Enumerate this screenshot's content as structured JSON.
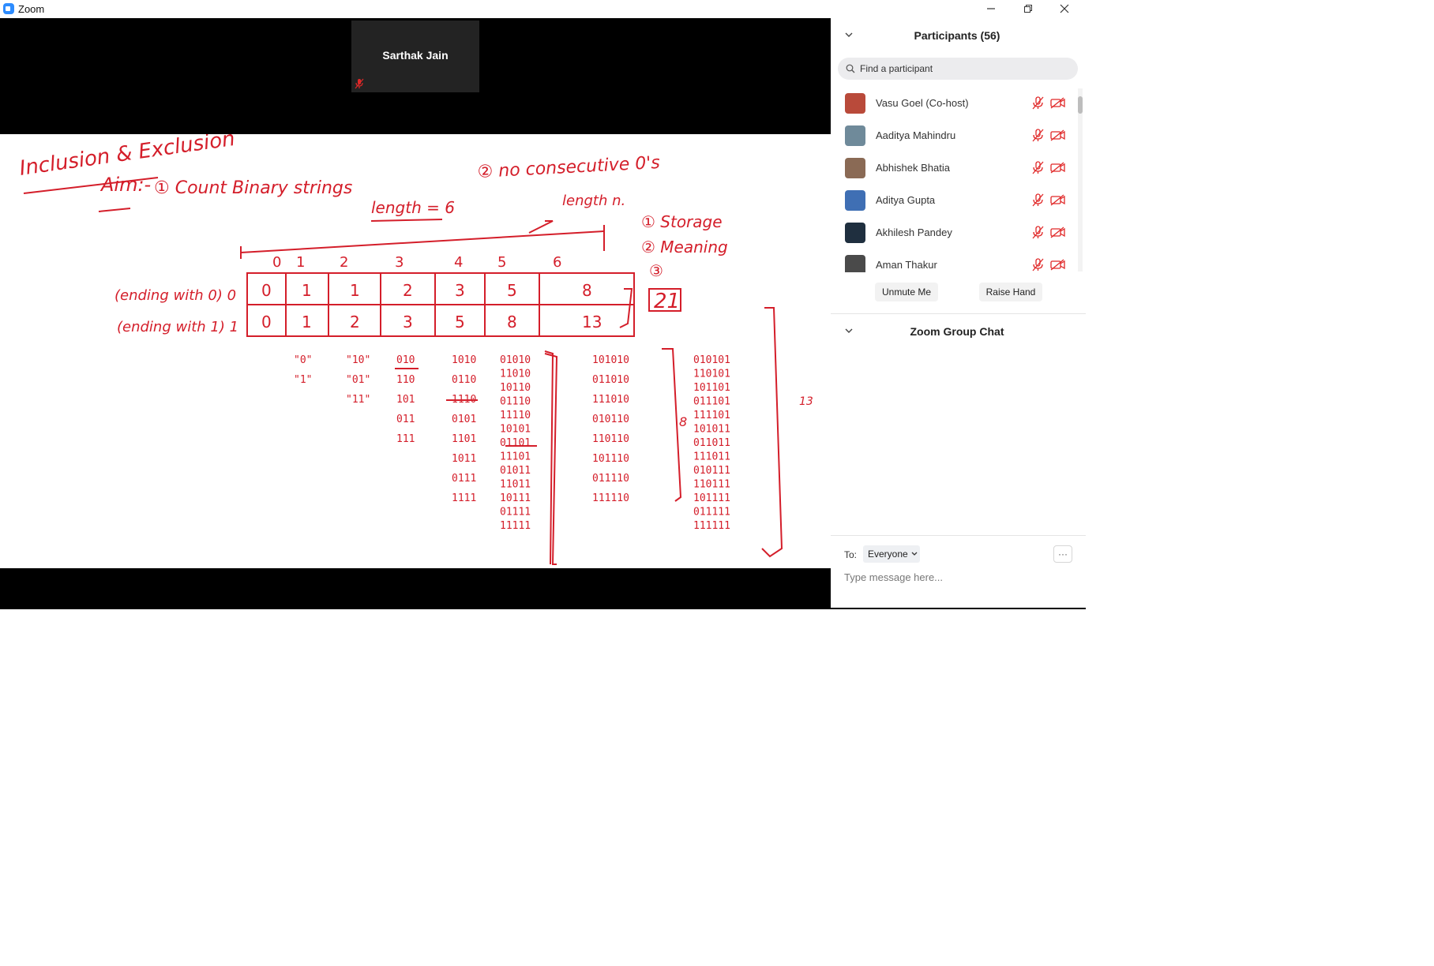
{
  "window": {
    "title": "Zoom",
    "accent_color": "#2d8cff"
  },
  "video": {
    "speaker_name": "Sarthak Jain",
    "speaker_muted": true,
    "whiteboard": {
      "title": "Inclusion & Exclusion",
      "aim_label": "Aim:-",
      "aim_items": [
        "① Count Binary strings",
        "② no consecutive 0's"
      ],
      "length_note": "length = 6",
      "length_n_note": "length n.",
      "steps": [
        "① Storage",
        "② Meaning",
        "③"
      ],
      "column_indices": [
        "0",
        "1",
        "2",
        "3",
        "4",
        "5",
        "6"
      ],
      "row_labels": [
        "(ending with 0)  0",
        "(ending with 1)  1"
      ],
      "table_rows": [
        [
          "0",
          "1",
          "1",
          "2",
          "3",
          "5",
          "8"
        ],
        [
          "0",
          "1",
          "2",
          "3",
          "5",
          "8",
          "13"
        ]
      ],
      "result": "21",
      "ink_color": "#d41e2a",
      "string_columns": [
        [
          "\"0\"",
          "\"1\""
        ],
        [
          "\"10\"",
          "\"01\"",
          "\"11\""
        ],
        [
          "010",
          "110",
          "101",
          "011",
          "111"
        ],
        [
          "1010",
          "0110",
          "1110",
          "0101",
          "1101",
          "1011",
          "0111",
          "1111"
        ],
        [
          "01010",
          "11010",
          "10110",
          "01110",
          "11110",
          "10101",
          "01101",
          "11101",
          "01011",
          "11011",
          "10111",
          "01111",
          "11111"
        ],
        [
          "101010",
          "011010",
          "111010",
          "010110",
          "110110",
          "101110",
          "011110",
          "111110"
        ],
        [
          "010101",
          "110101",
          "101101",
          "011101",
          "111101",
          "101011",
          "011011",
          "111011",
          "010111",
          "110111",
          "101111",
          "011111",
          "111111"
        ]
      ],
      "side_counts": [
        "13",
        "8"
      ]
    }
  },
  "participants": {
    "title": "Participants (56)",
    "search_placeholder": "Find a participant",
    "list": [
      {
        "name": "Vasu Goel (Co-host)",
        "avatar_color": "#b94a3a",
        "mic": "muted",
        "video": "off"
      },
      {
        "name": "Aaditya Mahindru",
        "avatar_color": "#6f8a9a",
        "mic": "muted",
        "video": "off"
      },
      {
        "name": "Abhishek Bhatia",
        "avatar_color": "#8a6a55",
        "mic": "muted",
        "video": "off"
      },
      {
        "name": "Aditya Gupta",
        "avatar_color": "#3f6fb4",
        "mic": "muted",
        "video": "off"
      },
      {
        "name": "Akhilesh Pandey",
        "avatar_color": "#1f2f3f",
        "mic": "muted",
        "video": "off"
      },
      {
        "name": "Aman Thakur",
        "avatar_color": "#4a4a4a",
        "mic": "muted",
        "video": "off"
      }
    ],
    "unmute_label": "Unmute Me",
    "raise_hand_label": "Raise Hand"
  },
  "chat": {
    "title": "Zoom Group Chat",
    "to_label": "To:",
    "recipient": "Everyone",
    "more_label": "···",
    "input_placeholder": "Type message here..."
  }
}
